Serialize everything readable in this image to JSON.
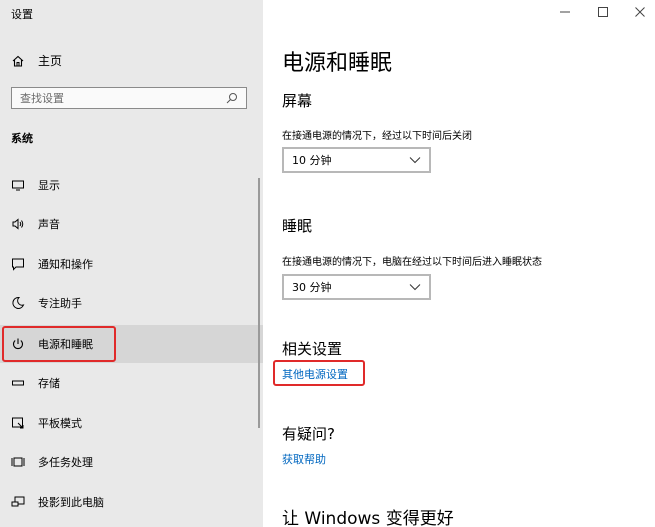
{
  "app": {
    "title": "设置"
  },
  "sidebar": {
    "home_label": "主页",
    "search_placeholder": "查找设置",
    "section_label": "系统",
    "items": [
      {
        "label": "显示",
        "icon": "monitor-icon"
      },
      {
        "label": "声音",
        "icon": "speaker-icon"
      },
      {
        "label": "通知和操作",
        "icon": "notification-icon"
      },
      {
        "label": "专注助手",
        "icon": "moon-icon"
      },
      {
        "label": "电源和睡眠",
        "icon": "power-icon",
        "selected": true
      },
      {
        "label": "存储",
        "icon": "storage-icon"
      },
      {
        "label": "平板模式",
        "icon": "tablet-icon"
      },
      {
        "label": "多任务处理",
        "icon": "multitask-icon"
      },
      {
        "label": "投影到此电脑",
        "icon": "project-icon"
      }
    ]
  },
  "window_controls": {
    "minimize": "–",
    "maximize": "☐",
    "close": "✕"
  },
  "main": {
    "title": "电源和睡眠",
    "screen": {
      "heading": "屏幕",
      "description": "在接通电源的情况下，经过以下时间后关闭",
      "value": "10 分钟"
    },
    "sleep": {
      "heading": "睡眠",
      "description": "在接通电源的情况下，电脑在经过以下时间后进入睡眠状态",
      "value": "30 分钟"
    },
    "related": {
      "heading": "相关设置",
      "link": "其他电源设置"
    },
    "question": {
      "heading": "有疑问?",
      "link": "获取帮助"
    },
    "improve_heading": "让 Windows 变得更好"
  },
  "colors": {
    "sidebar_bg": "#e9e9e9",
    "accent_link": "#0067c0",
    "highlight_border": "#e02a2a"
  }
}
